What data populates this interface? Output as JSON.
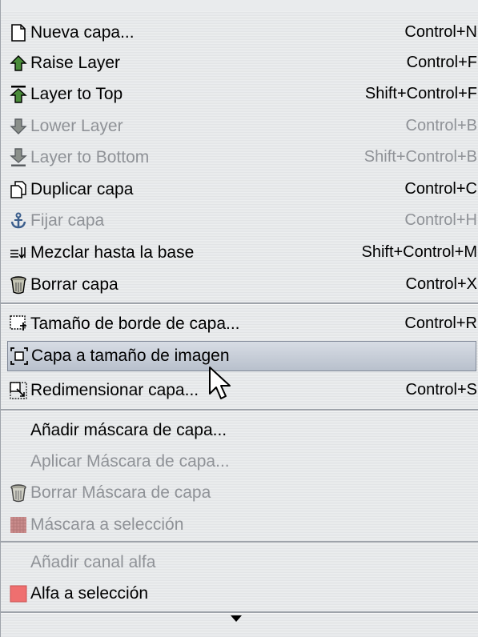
{
  "menu": {
    "items": [
      {
        "label": "Nueva capa...",
        "accel": "Control+N",
        "icon": "new-page-icon",
        "disabled": false
      },
      {
        "label": "Raise Layer",
        "accel": "Control+F",
        "icon": "arrow-up-icon",
        "disabled": false
      },
      {
        "label": "Layer to Top",
        "accel": "Shift+Control+F",
        "icon": "arrow-to-top-icon",
        "disabled": false
      },
      {
        "label": "Lower Layer",
        "accel": "Control+B",
        "icon": "arrow-down-icon",
        "disabled": true
      },
      {
        "label": "Layer to Bottom",
        "accel": "Shift+Control+B",
        "icon": "arrow-to-bottom-icon",
        "disabled": true
      },
      {
        "label": "Duplicar capa",
        "accel": "Control+C",
        "icon": "duplicate-icon",
        "disabled": false
      },
      {
        "label": "Fijar capa",
        "accel": "Control+H",
        "icon": "anchor-icon",
        "disabled": true
      },
      {
        "label": "Mezclar hasta la base",
        "accel": "Shift+Control+M",
        "icon": "merge-down-icon",
        "disabled": false
      },
      {
        "label": "Borrar capa",
        "accel": "Control+X",
        "icon": "trash-icon",
        "disabled": false
      },
      {
        "label": "Tamaño de borde de capa...",
        "accel": "Control+R",
        "icon": "layer-boundary-size-icon",
        "disabled": false
      },
      {
        "label": "Capa a tamaño de imagen",
        "accel": "",
        "icon": "layer-to-image-size-icon",
        "disabled": false,
        "highlighted": true
      },
      {
        "label": "Redimensionar capa...",
        "accel": "Control+S",
        "icon": "scale-layer-icon",
        "disabled": false
      },
      {
        "label": "Añadir máscara de capa...",
        "accel": "",
        "icon": "",
        "disabled": false
      },
      {
        "label": "Aplicar Máscara de capa...",
        "accel": "",
        "icon": "",
        "disabled": true
      },
      {
        "label": "Borrar Máscara de capa",
        "accel": "",
        "icon": "trash-icon",
        "disabled": true
      },
      {
        "label": "Máscara a selección",
        "accel": "",
        "icon": "mask-to-selection-icon",
        "disabled": true
      },
      {
        "label": "Añadir canal alfa",
        "accel": "",
        "icon": "",
        "disabled": true
      },
      {
        "label": "Alfa a selección",
        "accel": "",
        "icon": "alpha-to-selection-icon",
        "disabled": false
      }
    ]
  },
  "colors": {
    "highlight_top": "#d7dce4",
    "highlight_bottom": "#b8c0cc",
    "disabled_text": "#8f9297",
    "alpha_swatch": "#ef6f6f",
    "mask_swatch": "#c98b8b"
  }
}
